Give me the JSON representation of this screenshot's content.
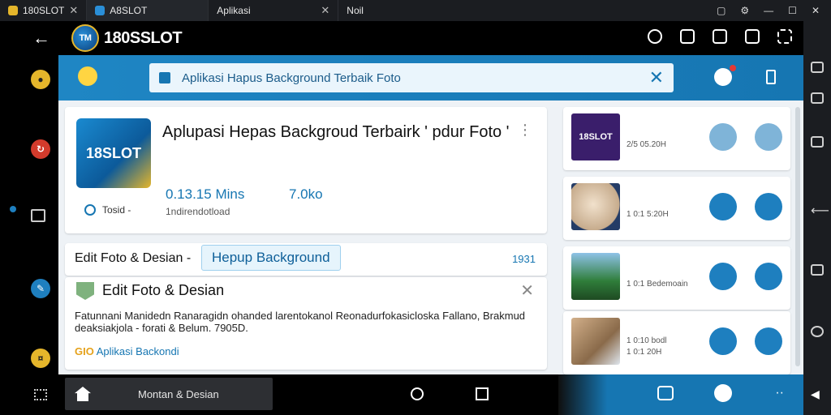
{
  "tabs": [
    {
      "label": "180SLOT",
      "active": false
    },
    {
      "label": "A8SLOT",
      "active": true
    },
    {
      "label": "Aplikasi",
      "active": false
    },
    {
      "label": "Noil",
      "active": false
    }
  ],
  "app": {
    "logo_text": "180SSLOT",
    "logo_badge": "TM"
  },
  "search": {
    "value": "Aplikasi Hapus Background Terbaik Foto"
  },
  "hero": {
    "thumb_text": "18SLOT",
    "title": "Aplupasi Hepas Backgroud Terbairk ' pdur Foto '",
    "stat_time": "0.13.15 Mins",
    "stat_size": "7.0ko",
    "search_label": "Tosid -",
    "sub_label": "1ndirendotload"
  },
  "edit_row": {
    "label": "Edit Foto & Desian -",
    "chip": "Hepup Background",
    "number": "1931"
  },
  "detail": {
    "title": "Edit Foto & Desian",
    "body": "Fatunnani Manidedn Ranaragidn ohanded larentokanol Reonadurfokasicloska Fallano, Brakmud deaksiakjola - forati & Belum. 7905D.",
    "tag_prefix": "GIO",
    "tag_text": "Aplikasi Backondi"
  },
  "side_items": [
    {
      "thumb_text": "18SLOT",
      "meta1": "2/5 05.20H",
      "meta2": "",
      "thumb_color": "#3a1e6b"
    },
    {
      "thumb_text": "",
      "meta1": "1 0:1 5:20H",
      "meta2": "",
      "thumb_color": "#d8c2a8"
    },
    {
      "thumb_text": "",
      "meta1": "1 0:1 Bedemoain",
      "meta2": "",
      "thumb_color": "#2f7d3a"
    },
    {
      "thumb_text": "",
      "meta1": "1 0:10 bodl",
      "meta2": "1 0:1 20H",
      "thumb_color": "#8a6a4a"
    }
  ],
  "bottom_nav": {
    "home_label": "Montan & Desian"
  }
}
